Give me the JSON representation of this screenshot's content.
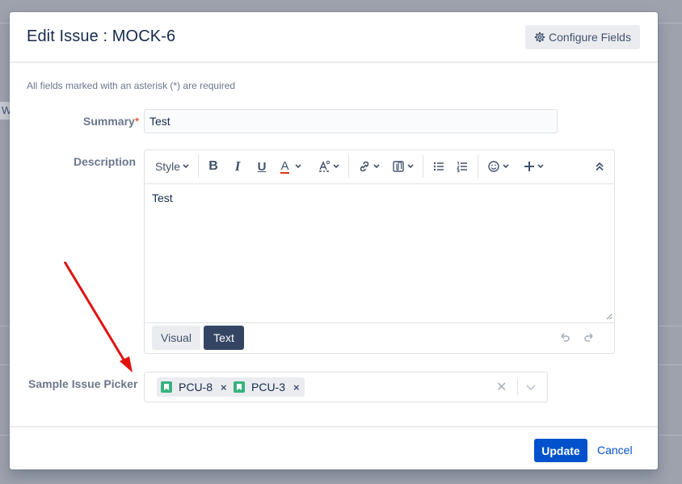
{
  "dialog": {
    "title": "Edit Issue : MOCK-6",
    "configure_fields_label": "Configure Fields",
    "required_note": "All fields marked with an asterisk (*) are required"
  },
  "summary": {
    "label": "Summary",
    "asterisk": "*",
    "value": "Test"
  },
  "description": {
    "label": "Description",
    "toolbar": {
      "style_label": "Style",
      "bold": "B",
      "italic": "I",
      "underline": "U",
      "text_color": "A",
      "icons": [
        "bold-icon",
        "italic-icon",
        "underline-icon",
        "text-color-icon",
        "text-effects-icon",
        "link-icon",
        "attachment-icon",
        "bullet-list-icon",
        "numbered-list-icon",
        "emoji-icon",
        "insert-more-icon",
        "collapse-toolbar-icon"
      ]
    },
    "body_text": "Test",
    "mode_visual": "Visual",
    "mode_text": "Text"
  },
  "issue_picker": {
    "label": "Sample Issue Picker",
    "selected": [
      "PCU-8",
      "PCU-3"
    ]
  },
  "footer": {
    "update_label": "Update",
    "cancel_label": "Cancel"
  },
  "colors": {
    "primary": "#0052cc",
    "required": "#de350b",
    "story_icon": "#36b37e",
    "annotation_arrow": "#e0120f",
    "mode_active": "#344563"
  }
}
